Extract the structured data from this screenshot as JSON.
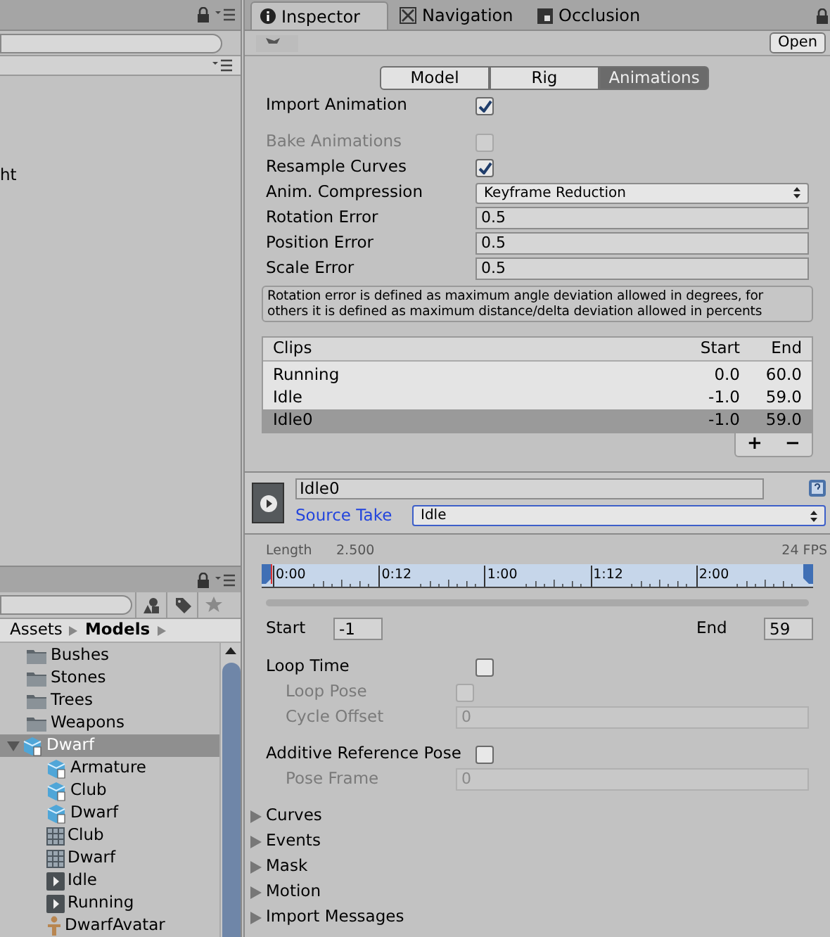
{
  "hierarchy": {
    "items": [
      {
        "label": "ht"
      }
    ]
  },
  "project": {
    "breadcrumb": [
      {
        "label": "Assets",
        "current": false
      },
      {
        "label": "Models",
        "current": true
      }
    ],
    "items": [
      {
        "kind": "folder",
        "label": "Bushes",
        "selected": false
      },
      {
        "kind": "folder",
        "label": "Stones",
        "selected": false
      },
      {
        "kind": "folder",
        "label": "Trees",
        "selected": false
      },
      {
        "kind": "folder",
        "label": "Weapons",
        "selected": false
      },
      {
        "kind": "model",
        "label": "Dwarf",
        "selected": true,
        "expanded": true,
        "children": [
          {
            "kind": "model",
            "label": "Armature",
            "selected": false
          },
          {
            "kind": "model",
            "label": "Club",
            "selected": false
          },
          {
            "kind": "model",
            "label": "Dwarf",
            "selected": false
          },
          {
            "kind": "mesh",
            "label": "Club",
            "selected": false
          },
          {
            "kind": "mesh",
            "label": "Dwarf",
            "selected": false
          },
          {
            "kind": "animation",
            "label": "Idle",
            "selected": false
          },
          {
            "kind": "animation",
            "label": "Running",
            "selected": false
          },
          {
            "kind": "avatar",
            "label": "DwarfAvatar",
            "selected": false
          }
        ]
      }
    ]
  },
  "tabs": [
    {
      "label": "Inspector",
      "selected": true
    },
    {
      "label": "Navigation",
      "selected": false
    },
    {
      "label": "Occlusion",
      "selected": false
    }
  ],
  "header": {
    "open_button": "Open"
  },
  "importer_tabs": [
    {
      "label": "Model",
      "selected": false
    },
    {
      "label": "Rig",
      "selected": false
    },
    {
      "label": "Animations",
      "selected": true
    }
  ],
  "import_animation": {
    "label": "Import Animation",
    "checked": true
  },
  "settings": [
    {
      "kind": "checkbox",
      "label": "Bake Animations",
      "checked": false,
      "disabled": true
    },
    {
      "kind": "checkbox",
      "label": "Resample Curves",
      "checked": true,
      "disabled": false
    },
    {
      "kind": "dropdown",
      "label": "Anim. Compression",
      "value": "Keyframe Reduction",
      "disabled": false
    },
    {
      "kind": "number",
      "label": "Rotation Error",
      "value": "0.5",
      "disabled": false
    },
    {
      "kind": "number",
      "label": "Position Error",
      "value": "0.5",
      "disabled": false
    },
    {
      "kind": "number",
      "label": "Scale Error",
      "value": "0.5",
      "disabled": false
    }
  ],
  "help_text": "Rotation error is defined as maximum angle deviation allowed in degrees, for others it is defined as maximum distance/delta deviation allowed in percents",
  "clips": {
    "columns": [
      "Clips",
      "Start",
      "End"
    ],
    "rows": [
      {
        "name": "Running",
        "start": "0.0",
        "end": "60.0",
        "selected": false
      },
      {
        "name": "Idle",
        "start": "-1.0",
        "end": "59.0",
        "selected": false
      },
      {
        "name": "Idle0",
        "start": "-1.0",
        "end": "59.0",
        "selected": true
      }
    ],
    "buttons": [
      "+",
      "−"
    ]
  },
  "clip": {
    "name": "Idle0",
    "source_take_label": "Source Take",
    "source_take": "Idle",
    "length_label": "Length",
    "length": "2.500",
    "fps": "24 FPS",
    "ticks": [
      "0:00",
      "0:12",
      "1:00",
      "1:12",
      "2:00"
    ],
    "start_label": "Start",
    "start": "-1",
    "end_label": "End",
    "end": "59",
    "loop": [
      {
        "kind": "checkbox",
        "label": "Loop Time",
        "checked": false,
        "disabled": false,
        "children": [
          {
            "kind": "checkbox",
            "label": "Loop Pose",
            "checked": false,
            "disabled": true
          },
          {
            "kind": "number",
            "label": "Cycle Offset",
            "value": "0",
            "disabled": true
          }
        ]
      },
      {
        "kind": "checkbox",
        "label": "Additive Reference Pose",
        "checked": false,
        "disabled": false,
        "children": [
          {
            "kind": "number",
            "label": "Pose Frame",
            "value": "0",
            "disabled": true
          }
        ]
      }
    ],
    "foldouts": [
      {
        "label": "Curves",
        "expanded": false
      },
      {
        "label": "Events",
        "expanded": false
      },
      {
        "label": "Mask",
        "expanded": false
      },
      {
        "label": "Motion",
        "expanded": false
      },
      {
        "label": "Import Messages",
        "expanded": false
      }
    ]
  }
}
